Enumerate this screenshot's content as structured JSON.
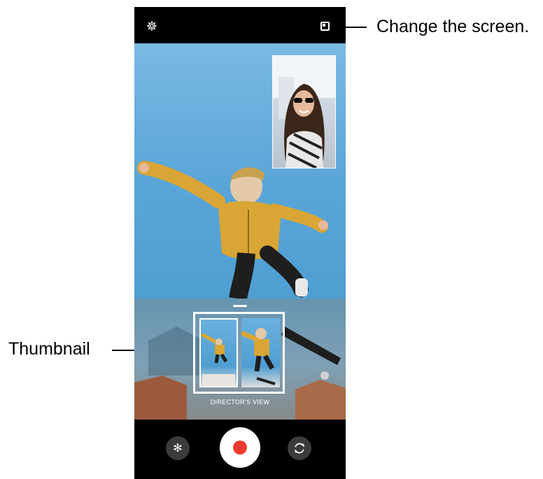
{
  "callouts": {
    "change_screen": "Change the screen.",
    "thumbnail": "Thumbnail"
  },
  "topbar": {
    "settings_icon": "gear-icon",
    "screen_icon": "picture-in-picture-icon"
  },
  "bottom_panel": {
    "mode_label": "DIRECTOR'S VIEW"
  },
  "controls": {
    "effects_glyph": "✻",
    "effects_icon": "effects-icon",
    "record_icon": "record-icon",
    "flip_icon": "switch-camera-icon",
    "record_color": "#ea3b2c"
  }
}
